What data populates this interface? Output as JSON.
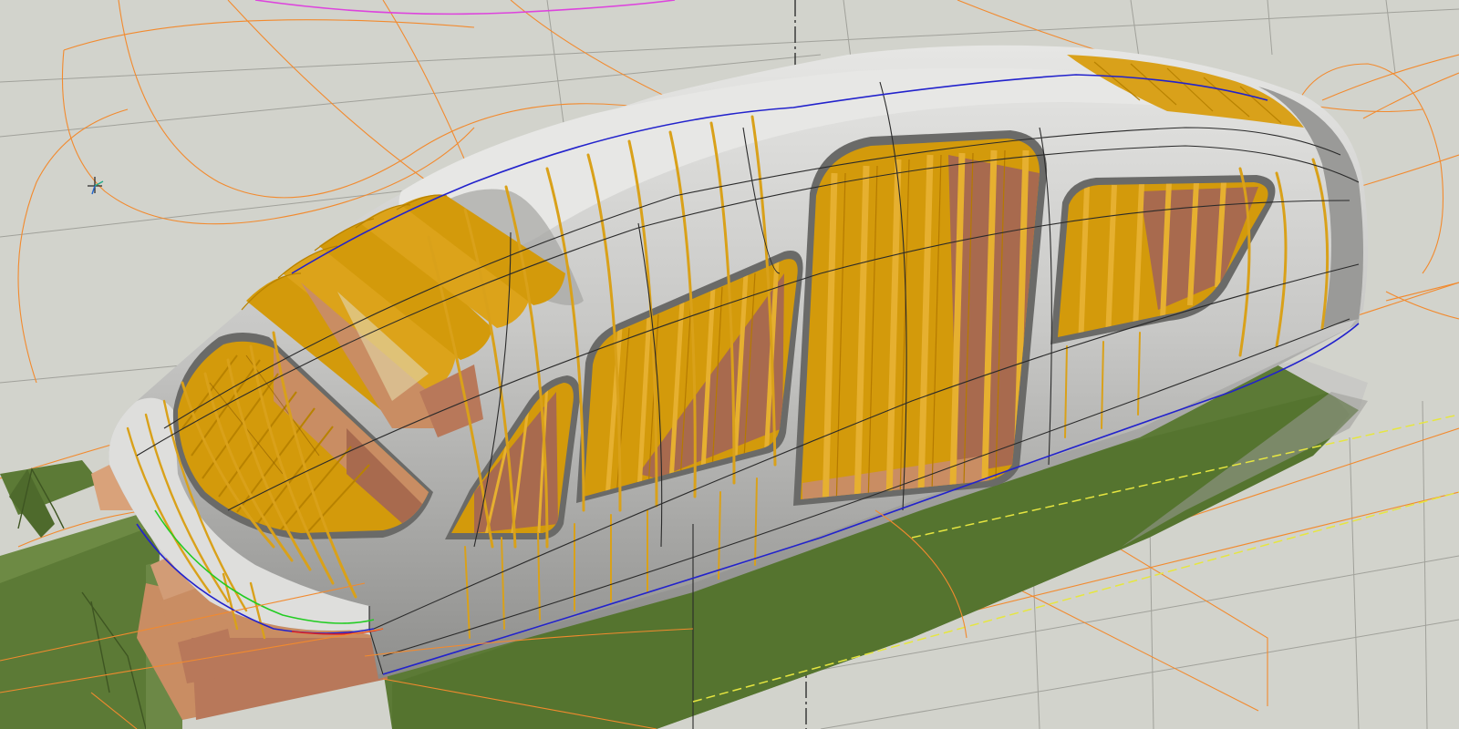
{
  "viewport": {
    "background": "#d2d3cc",
    "render_mode": "shaded-with-edges"
  },
  "colors": {
    "shell_light": "#e4e4e2",
    "shell_mid": "#bdbdbb",
    "shell_dark": "#8d8d8b",
    "window_frame": "#6a6a68",
    "frame_ribs": "#d39a0b",
    "frame_ribs_light": "#e1ac22",
    "interior_wood": "#c98d63",
    "interior_wood_dark": "#a86a4e",
    "base_plate": "#5c7a36",
    "base_plate_dark": "#4e6a2c",
    "construction_orange": "#f28a2e",
    "construction_grid": "#8c8c86",
    "curve_blue": "#2222cc",
    "curve_magenta": "#dd44dd",
    "curve_green": "#22cc22",
    "curve_red": "#dd2222",
    "curve_yellow": "#e6e640"
  },
  "icons": [
    "coordinate-triad-icon"
  ]
}
